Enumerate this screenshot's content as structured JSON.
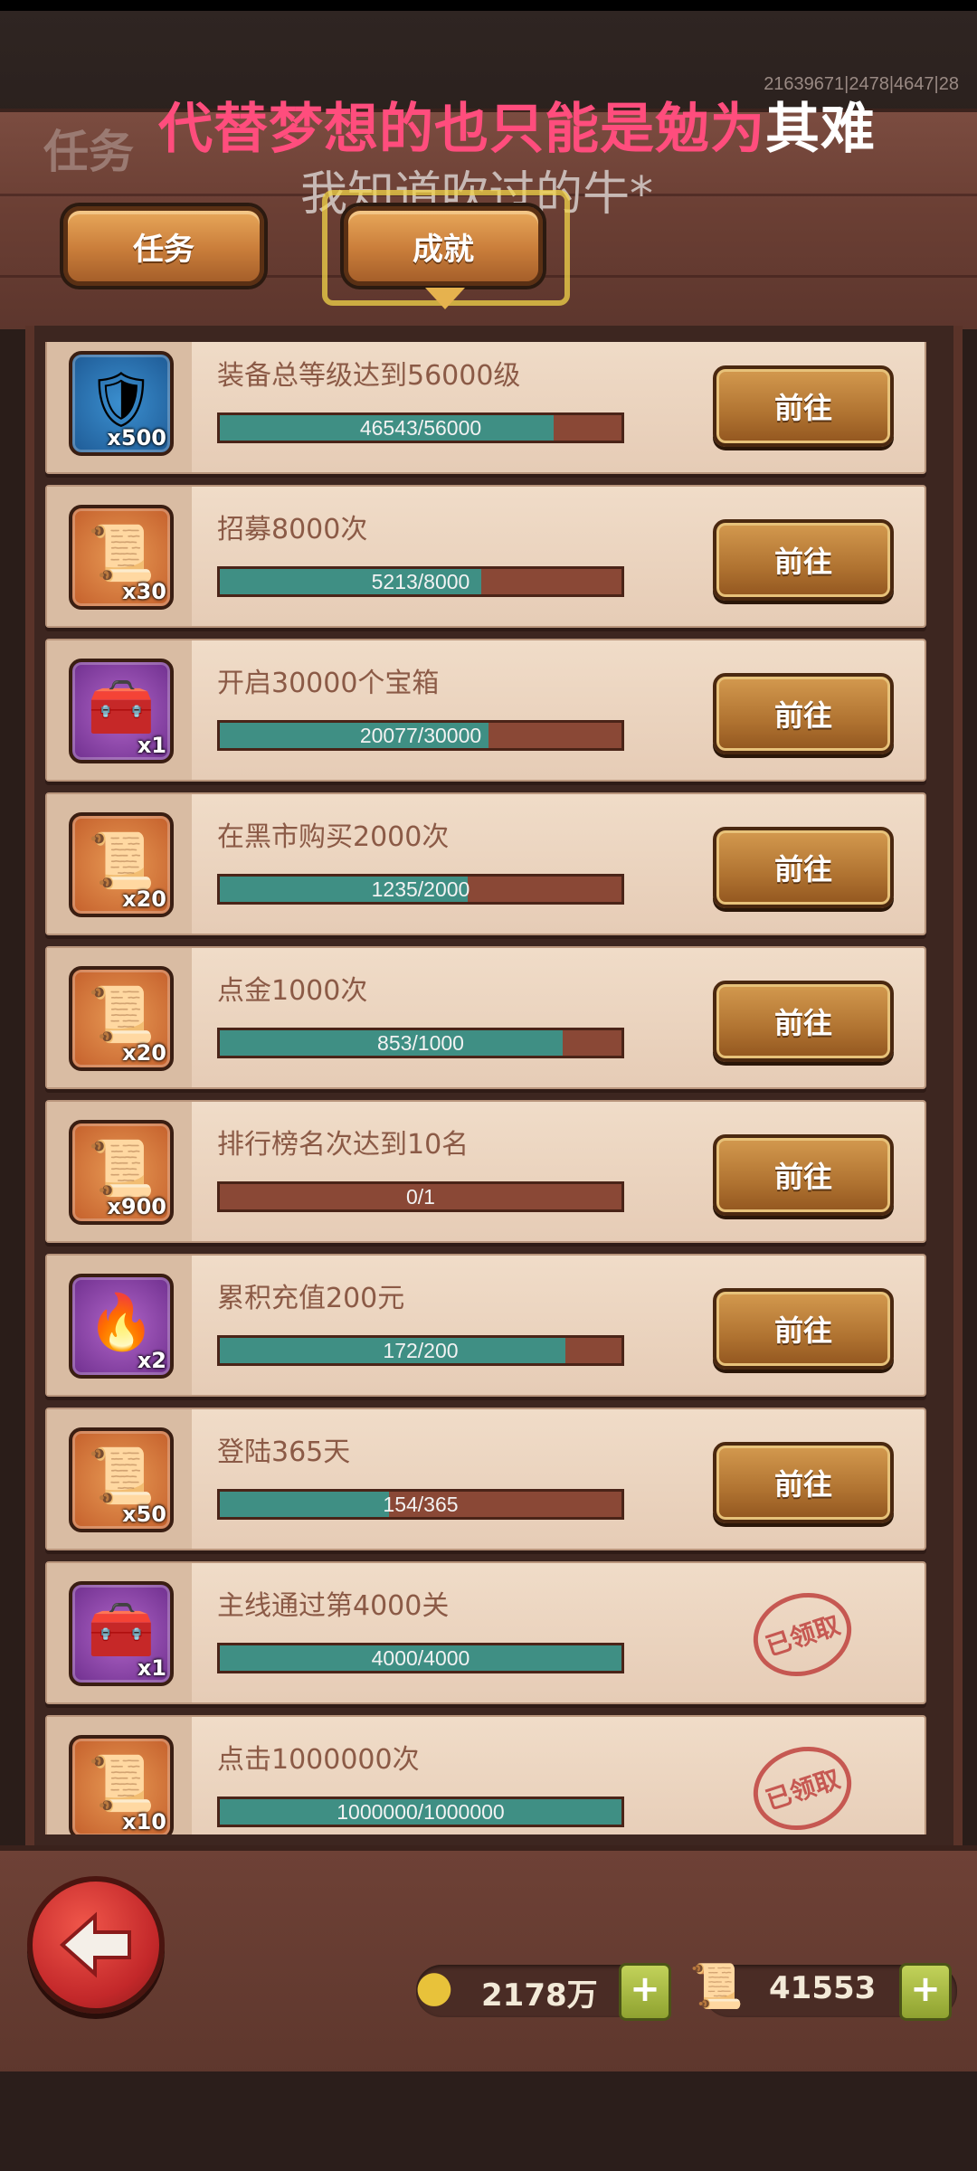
{
  "header": {
    "title": "任务",
    "stats": "21639671|2478|4647|28",
    "lyric_line1_main": "代替梦想的也只能是勉为",
    "lyric_line1_end": "其难",
    "lyric_line2": "我知道吹过的牛*"
  },
  "tabs": [
    {
      "label": "任务"
    },
    {
      "label": "成就"
    }
  ],
  "achievements": [
    {
      "title": "装备总等级达到56000级",
      "progress": "46543/56000",
      "ratio": 0.831,
      "reward_qty": "x500",
      "reward_icon": "equipment-icon",
      "rarity": "blue",
      "status": "前往"
    },
    {
      "title": "招募8000次",
      "progress": "5213/8000",
      "ratio": 0.652,
      "reward_qty": "x30",
      "reward_icon": "scroll-icon",
      "rarity": "orange",
      "status": "前往"
    },
    {
      "title": "开启30000个宝箱",
      "progress": "20077/30000",
      "ratio": 0.669,
      "reward_qty": "x1",
      "reward_icon": "chest-icon",
      "rarity": "purple",
      "status": "前往"
    },
    {
      "title": "在黑市购买2000次",
      "progress": "1235/2000",
      "ratio": 0.618,
      "reward_qty": "x20",
      "reward_icon": "scroll-icon",
      "rarity": "orange",
      "status": "前往"
    },
    {
      "title": "点金1000次",
      "progress": "853/1000",
      "ratio": 0.853,
      "reward_qty": "x20",
      "reward_icon": "scroll-icon",
      "rarity": "orange",
      "status": "前往"
    },
    {
      "title": "排行榜名次达到10名",
      "progress": "0/1",
      "ratio": 0.0,
      "reward_qty": "x900",
      "reward_icon": "scroll-icon",
      "rarity": "orange",
      "status": "前往"
    },
    {
      "title": "累积充值200元",
      "progress": "172/200",
      "ratio": 0.86,
      "reward_qty": "x2",
      "reward_icon": "torch-icon",
      "rarity": "purple",
      "status": "前往"
    },
    {
      "title": "登陆365天",
      "progress": "154/365",
      "ratio": 0.422,
      "reward_qty": "x50",
      "reward_icon": "scroll-icon",
      "rarity": "orange",
      "status": "前往"
    },
    {
      "title": "主线通过第4000关",
      "progress": "4000/4000",
      "ratio": 1.0,
      "reward_qty": "x1",
      "reward_icon": "chest-icon",
      "rarity": "purple",
      "status": "已领取"
    },
    {
      "title": "点击1000000次",
      "progress": "1000000/1000000",
      "ratio": 1.0,
      "reward_qty": "x10",
      "reward_icon": "scroll-icon",
      "rarity": "orange",
      "status": "已领取"
    }
  ],
  "resources": {
    "gold": "2178万",
    "scrolls": "41553",
    "plus": "+"
  },
  "colors": {
    "progress_fill": "#3f8f84",
    "progress_track": "#8a4836",
    "lyric_pink": "#ff4d7d",
    "stamp_red": "#c0433f"
  }
}
